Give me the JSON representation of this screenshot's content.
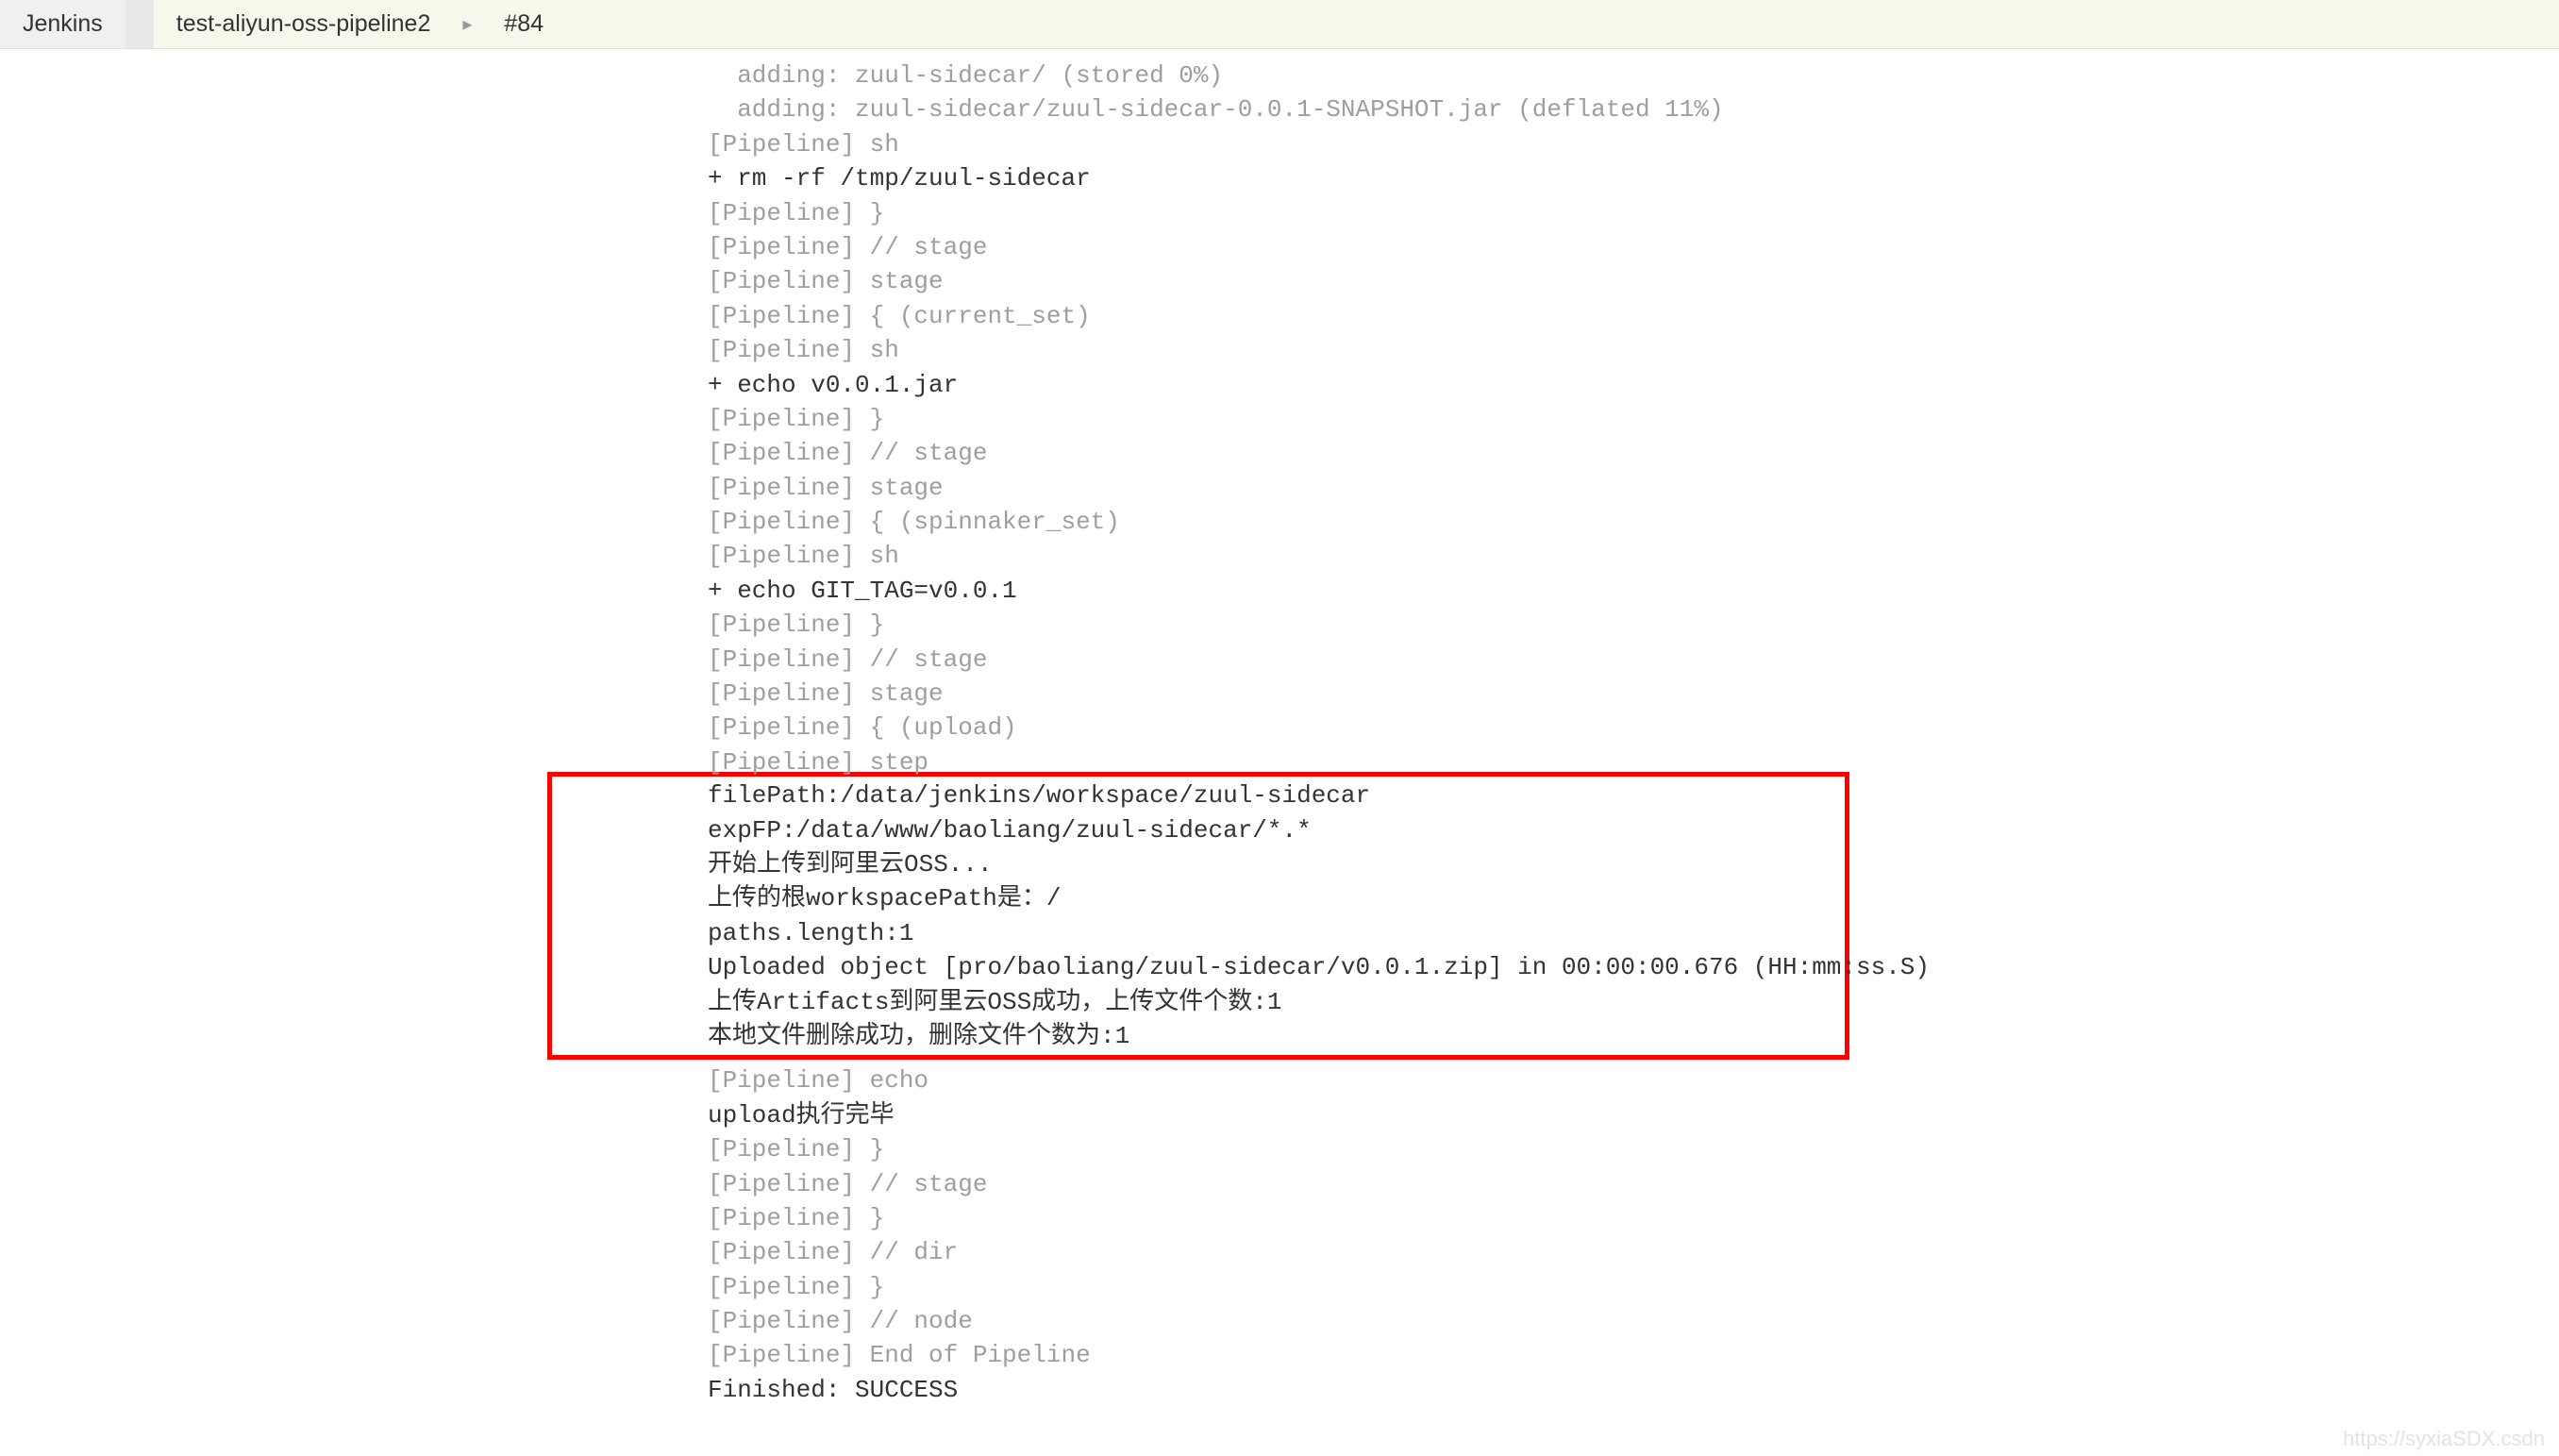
{
  "breadcrumb": {
    "root": "Jenkins",
    "pipeline": "test-aliyun-oss-pipeline2",
    "build": "#84"
  },
  "console": {
    "lines": [
      {
        "cls": "meta",
        "text": "  adding: zuul-sidecar/ (stored 0%)"
      },
      {
        "cls": "meta",
        "text": "  adding: zuul-sidecar/zuul-sidecar-0.0.1-SNAPSHOT.jar (deflated 11%)"
      },
      {
        "cls": "meta",
        "text": "[Pipeline] sh"
      },
      {
        "cls": "cmd",
        "text": "+ rm -rf /tmp/zuul-sidecar"
      },
      {
        "cls": "meta",
        "text": "[Pipeline] }"
      },
      {
        "cls": "meta",
        "text": "[Pipeline] // stage"
      },
      {
        "cls": "meta",
        "text": "[Pipeline] stage"
      },
      {
        "cls": "meta",
        "text": "[Pipeline] { (current_set)"
      },
      {
        "cls": "meta",
        "text": "[Pipeline] sh"
      },
      {
        "cls": "cmd",
        "text": "+ echo v0.0.1.jar"
      },
      {
        "cls": "meta",
        "text": "[Pipeline] }"
      },
      {
        "cls": "meta",
        "text": "[Pipeline] // stage"
      },
      {
        "cls": "meta",
        "text": "[Pipeline] stage"
      },
      {
        "cls": "meta",
        "text": "[Pipeline] { (spinnaker_set)"
      },
      {
        "cls": "meta",
        "text": "[Pipeline] sh"
      },
      {
        "cls": "cmd",
        "text": "+ echo GIT_TAG=v0.0.1"
      },
      {
        "cls": "meta",
        "text": "[Pipeline] }"
      },
      {
        "cls": "meta",
        "text": "[Pipeline] // stage"
      },
      {
        "cls": "meta",
        "text": "[Pipeline] stage"
      },
      {
        "cls": "meta",
        "text": "[Pipeline] { (upload)"
      },
      {
        "cls": "meta",
        "text": "[Pipeline] step"
      }
    ],
    "highlighted": [
      {
        "text": "filePath:/data/jenkins/workspace/zuul-sidecar"
      },
      {
        "text": "expFP:/data/www/baoliang/zuul-sidecar/*.*"
      },
      {
        "text": "开始上传到阿里云OSS..."
      },
      {
        "text": "上传的根workspacePath是：/"
      },
      {
        "text": "paths.length:1"
      },
      {
        "text": "Uploaded object [pro/baoliang/zuul-sidecar/v0.0.1.zip] in 00:00:00.676 (HH:mm:ss.S)"
      },
      {
        "text": "上传Artifacts到阿里云OSS成功，上传文件个数:1"
      },
      {
        "text": "本地文件删除成功，删除文件个数为:1"
      }
    ],
    "trailing": [
      {
        "cls": "meta",
        "text": "[Pipeline] echo"
      },
      {
        "cls": "cmd",
        "text": "upload执行完毕"
      },
      {
        "cls": "meta",
        "text": "[Pipeline] }"
      },
      {
        "cls": "meta",
        "text": "[Pipeline] // stage"
      },
      {
        "cls": "meta",
        "text": "[Pipeline] }"
      },
      {
        "cls": "meta",
        "text": "[Pipeline] // dir"
      },
      {
        "cls": "meta",
        "text": "[Pipeline] }"
      },
      {
        "cls": "meta",
        "text": "[Pipeline] // node"
      },
      {
        "cls": "meta",
        "text": "[Pipeline] End of Pipeline"
      },
      {
        "cls": "cmd",
        "text": "Finished: SUCCESS"
      }
    ]
  },
  "watermark": "https://syxiaSDX.csdn"
}
